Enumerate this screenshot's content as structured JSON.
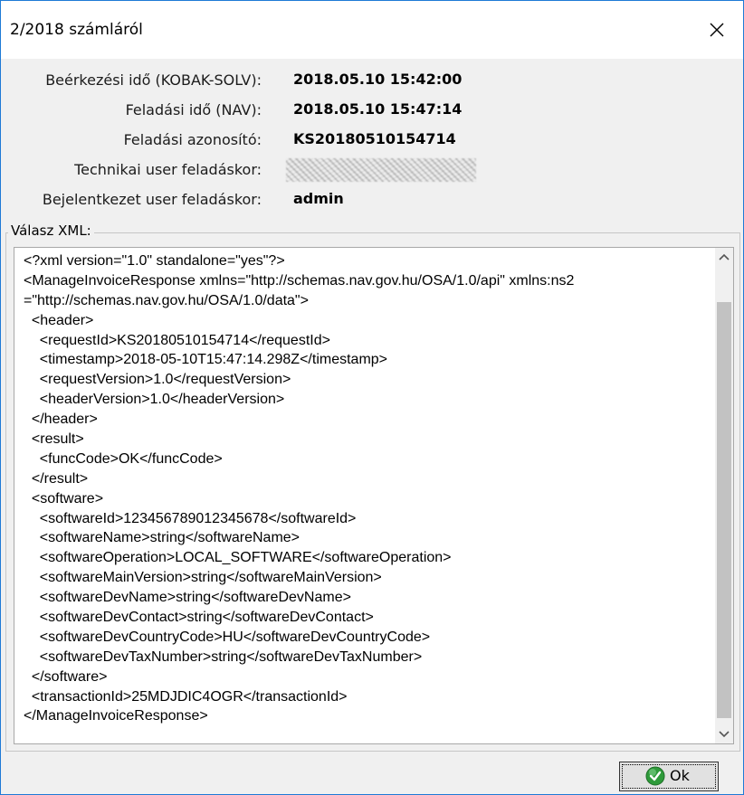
{
  "window": {
    "title": "2/2018 számláról"
  },
  "info": {
    "rows": [
      {
        "label": "Beérkezési idő (KOBAK-SOLV):",
        "value": "2018.05.10 15:42:00"
      },
      {
        "label": "Feladási idő (NAV):",
        "value": "2018.05.10 15:47:14"
      },
      {
        "label": "Feladási azonosító:",
        "value": "KS20180510154714"
      },
      {
        "label": "Technikai user feladáskor:",
        "value": ""
      },
      {
        "label": "Bejelentkezet user feladáskor:",
        "value": "admin"
      }
    ]
  },
  "xml_group": {
    "legend": "Válasz XML:",
    "lines": [
      "<?xml version=\"1.0\" standalone=\"yes\"?>",
      "<ManageInvoiceResponse xmlns=\"http://schemas.nav.gov.hu/OSA/1.0/api\" xmlns:ns2",
      "=\"http://schemas.nav.gov.hu/OSA/1.0/data\">",
      "  <header>",
      "    <requestId>KS20180510154714</requestId>",
      "    <timestamp>2018-05-10T15:47:14.298Z</timestamp>",
      "    <requestVersion>1.0</requestVersion>",
      "    <headerVersion>1.0</headerVersion>",
      "  </header>",
      "  <result>",
      "    <funcCode>OK</funcCode>",
      "  </result>",
      "  <software>",
      "    <softwareId>123456789012345678</softwareId>",
      "    <softwareName>string</softwareName>",
      "    <softwareOperation>LOCAL_SOFTWARE</softwareOperation>",
      "    <softwareMainVersion>string</softwareMainVersion>",
      "    <softwareDevName>string</softwareDevName>",
      "    <softwareDevContact>string</softwareDevContact>",
      "    <softwareDevCountryCode>HU</softwareDevCountryCode>",
      "    <softwareDevTaxNumber>string</softwareDevTaxNumber>",
      "  </software>",
      "  <transactionId>25MDJDIC4OGR</transactionId>",
      "</ManageInvoiceResponse>"
    ]
  },
  "buttons": {
    "ok_label": "Ok"
  },
  "icons": {
    "close": "close-icon",
    "ok": "check-circle-icon",
    "scroll_up": "chevron-up-icon",
    "scroll_down": "chevron-down-icon"
  },
  "colors": {
    "window_border": "#1e7ad6",
    "ok_icon": "#2e9a3a"
  }
}
